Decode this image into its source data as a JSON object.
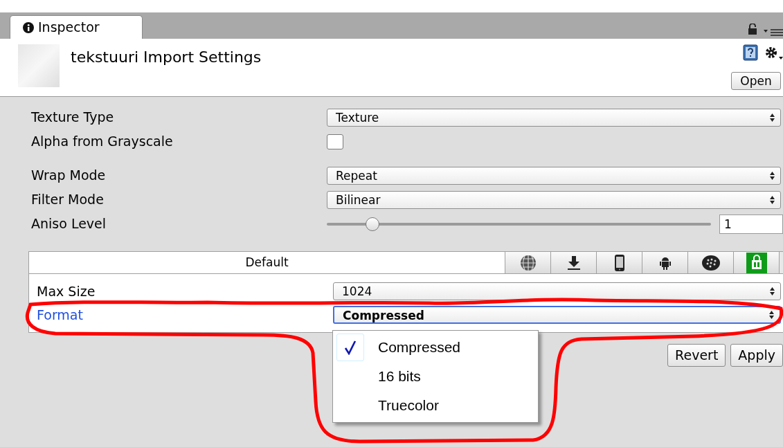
{
  "tab": {
    "label": "Inspector",
    "selected": true
  },
  "header": {
    "title": "tekstuuri Import Settings",
    "open_button": "Open"
  },
  "properties": [
    {
      "kind": "dropdown",
      "label": "Texture Type",
      "value": "Texture"
    },
    {
      "kind": "checkbox",
      "label": "Alpha from Grayscale",
      "checked": false
    },
    {
      "kind": "spacer"
    },
    {
      "kind": "dropdown",
      "label": "Wrap Mode",
      "value": "Repeat"
    },
    {
      "kind": "dropdown",
      "label": "Filter Mode",
      "value": "Bilinear"
    },
    {
      "kind": "slider",
      "label": "Aniso Level",
      "level": 0.12,
      "reading": "1"
    }
  ],
  "platform_tabs": [
    {
      "label": "Default",
      "selected": true
    },
    {
      "selected": false
    },
    {
      "selected": false
    },
    {
      "selected": false
    },
    {
      "selected": false
    },
    {
      "selected": false
    },
    {
      "selected": false
    }
  ],
  "platform_settings": [
    {
      "label": "Max Size",
      "value": "1024",
      "focused": false
    },
    {
      "label": "Format",
      "value": "Compressed",
      "focused": true
    }
  ],
  "format_menu": [
    {
      "label": "Compressed",
      "selected": true
    },
    {
      "label": "16 bits",
      "selected": false
    },
    {
      "label": "Truecolor",
      "selected": false
    }
  ],
  "buttons": [
    "Revert",
    "Apply"
  ]
}
